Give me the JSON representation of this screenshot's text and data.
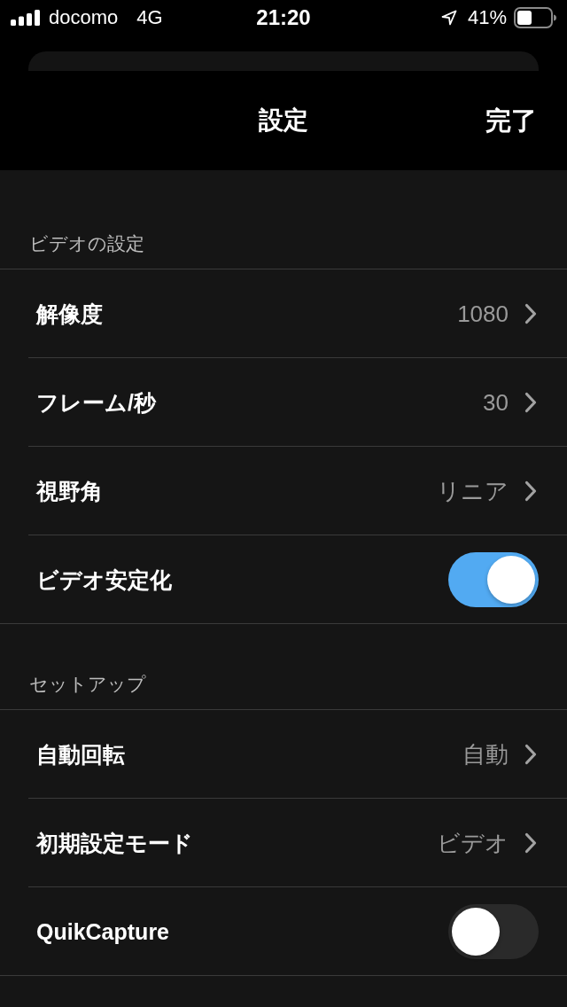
{
  "status_bar": {
    "carrier": "docomo",
    "network": "4G",
    "time": "21:20",
    "battery": "41%"
  },
  "nav": {
    "title": "設定",
    "done": "完了"
  },
  "sections": [
    {
      "header": "ビデオの設定",
      "rows": [
        {
          "kind": "link",
          "label": "解像度",
          "value": "1080"
        },
        {
          "kind": "link",
          "label": "フレーム/秒",
          "value": "30"
        },
        {
          "kind": "link",
          "label": "視野角",
          "value": "リニア"
        },
        {
          "kind": "toggle",
          "label": "ビデオ安定化",
          "on": true
        }
      ]
    },
    {
      "header": "セットアップ",
      "rows": [
        {
          "kind": "link",
          "label": "自動回転",
          "value": "自動"
        },
        {
          "kind": "link",
          "label": "初期設定モード",
          "value": "ビデオ"
        },
        {
          "kind": "toggle",
          "label": "QuikCapture",
          "on": false
        }
      ]
    }
  ]
}
